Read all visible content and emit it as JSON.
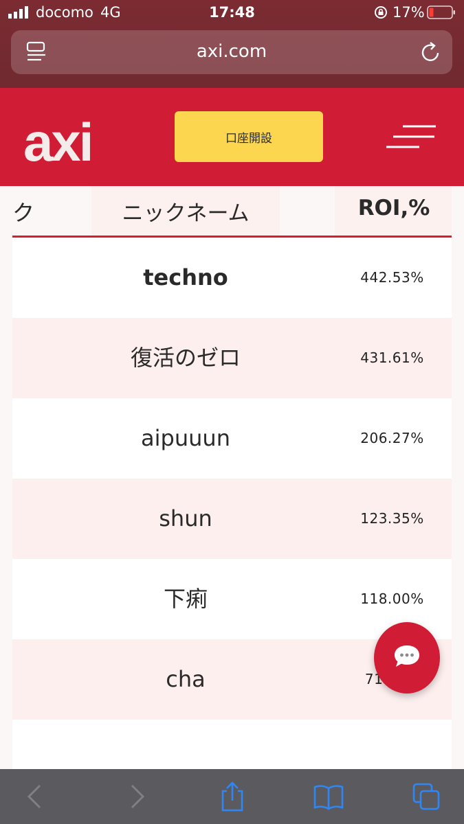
{
  "status_bar": {
    "carrier": "docomo",
    "network": "4G",
    "time": "17:48",
    "battery_percent": "17%"
  },
  "browser": {
    "url": "axi.com"
  },
  "site": {
    "logo_text": "axi",
    "open_account_label": "口座開設",
    "brand_color": "#d01d35",
    "button_color": "#fbd64e"
  },
  "table": {
    "headers": {
      "rank": "ク",
      "nickname": "ニックネーム",
      "roi": "ROI,%"
    },
    "rows": [
      {
        "nickname": "techno",
        "roi": "442.53%"
      },
      {
        "nickname": "復活のゼロ",
        "roi": "431.61%"
      },
      {
        "nickname": "aipuuun",
        "roi": "206.27%"
      },
      {
        "nickname": "shun",
        "roi": "123.35%"
      },
      {
        "nickname": "下痢",
        "roi": "118.00%"
      },
      {
        "nickname": "cha",
        "roi": "71.32%"
      }
    ]
  },
  "icons": {
    "chat": "chat-bubble-icon",
    "toolbar": [
      "back-icon",
      "forward-icon",
      "share-icon",
      "bookmarks-icon",
      "tabs-icon"
    ]
  }
}
